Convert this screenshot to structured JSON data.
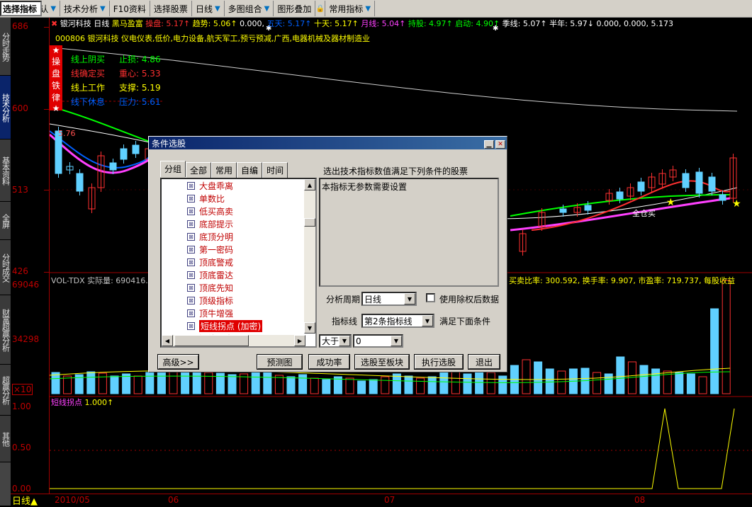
{
  "toolbar": {
    "items": [
      "Level2默认",
      "技术分析",
      "F10资料",
      "选择股票",
      "选择指标",
      "日线",
      "多图组合",
      "图形叠加",
      "常用指标"
    ]
  },
  "sidebar": {
    "tabs": [
      "分时走势",
      "技术分析",
      "基本资料",
      "全屏",
      "分时成交",
      "财富超赢分析",
      "超赢分析",
      "其他"
    ]
  },
  "axis": {
    "price": [
      "686",
      "600",
      "513",
      "426"
    ],
    "vol": [
      "69046",
      "34298",
      "×10"
    ],
    "ind": [
      "1.00",
      "0.50",
      "0.00"
    ]
  },
  "header": {
    "name": "银河科技 日线",
    "strategy": "黑马盈富",
    "caopan": "操盘: 5.17↑",
    "qushi": "趋势: 5.06↑",
    "dot1": "0.000,",
    "wutian": "五天: 5.17↑",
    "shitian": "十天: 5.17↑",
    "yuexian": "月线: 5.04↑",
    "chiyou": "持股: 4.97↑",
    "qidong": "启动: 4.90↑",
    "jixian": "季线: 5.07↑",
    "bannian": "半年: 5.97↓",
    "tail": "0.000, 0.000, 5.173"
  },
  "stockline": "000806 银河科技 仪电仪表,低价,电力设备,航天军工,预亏预减,广西,电器机械及器材制造业",
  "badge": {
    "chars": [
      "★",
      "操",
      "盘",
      "铁",
      "律",
      "★"
    ]
  },
  "rules": [
    {
      "l": "线上阴买",
      "r": "止损: 4.86"
    },
    {
      "l": "线确定买",
      "r": "重心: 5.33"
    },
    {
      "l": "线上工作",
      "r": "支撑: 5.19"
    },
    {
      "l": "线下休息",
      "r": "压力: 5.61"
    }
  ],
  "pricelabel": "5.76",
  "annot": "全仓买",
  "vol": {
    "title": "VOL-TDX 实际量: 690416.",
    "right": "买卖比率: 300.592, 换手率: 9.907, 市盈率: 719.737, 每股收益"
  },
  "ind": {
    "title": "短线拐点",
    "value": "1.000↑"
  },
  "dates": [
    "2010/05",
    "06",
    "07",
    "08"
  ],
  "bottom": {
    "period": "日线"
  },
  "dialog": {
    "title": "条件选股",
    "tabs": [
      "分组",
      "全部",
      "常用",
      "自编",
      "时间"
    ],
    "items": [
      "大盘乖离",
      "单数比",
      "低买高卖",
      "底部提示",
      "底顶分明",
      "第一密码",
      "顶底警戒",
      "顶底雷达",
      "顶底先知",
      "顶级指标",
      "顶牛增强",
      "短线拐点 (加密)",
      "短线狙击"
    ],
    "selected_index": 11,
    "heading": "选出技术指标数值满足下列条件的股票",
    "desc": "本指标无参数需要设置",
    "period_label": "分析周期",
    "period_value": "日线",
    "checkbox_label": "使用除权后数据",
    "line_label": "指标线",
    "line_value": "第2条指标线",
    "line_suffix": "满足下面条件",
    "op_value": "大于",
    "num_value": "0",
    "buttons": [
      "高级>>",
      "预测图",
      "成功率",
      "选股至板块",
      "执行选股",
      "退出"
    ]
  },
  "colors": {
    "red": "#ff3030",
    "yellow": "#ffff00",
    "cyan": "#60d0ff",
    "green": "#00ff00",
    "magenta": "#ff40ff",
    "white": "#ffffff"
  }
}
